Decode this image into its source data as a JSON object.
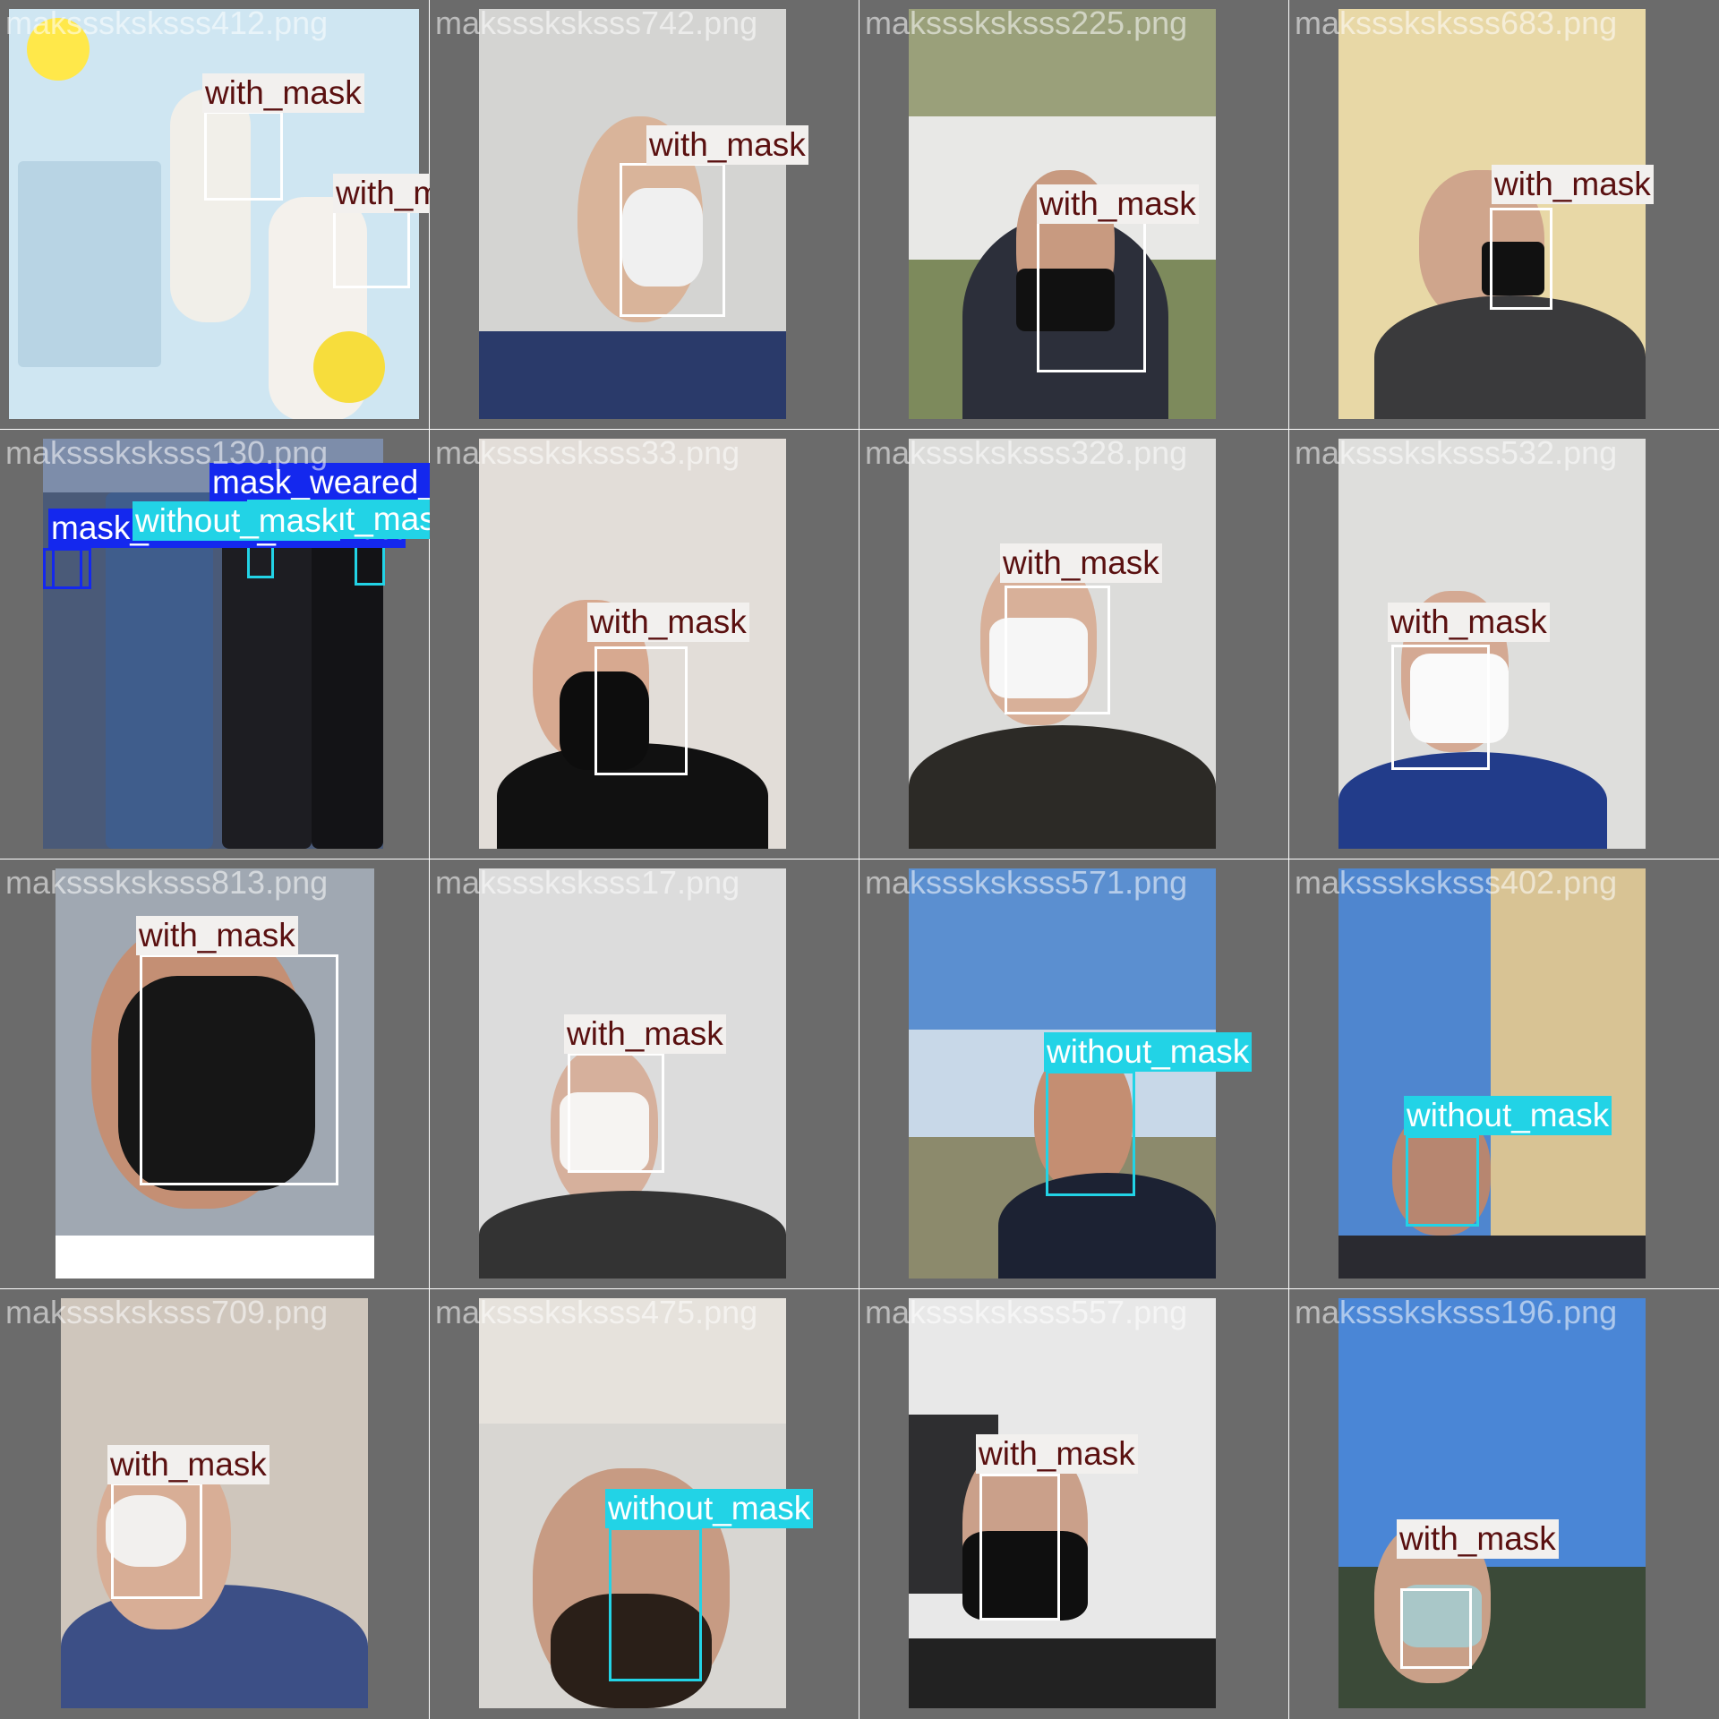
{
  "grid_title": "",
  "class_colors": {
    "with_mask": {
      "box": "#ffffff",
      "label_bg": "#f2f0ee",
      "label_fg": "#5a1010"
    },
    "without_mask": {
      "box": "#22d3e6",
      "label_bg": "#22d3e6",
      "label_fg": "#ffffff"
    },
    "mask_weared_incorrect": {
      "box": "#1428ee",
      "label_bg": "#1428ee",
      "label_fg": "#ffffff"
    }
  },
  "cells": [
    {
      "file": "maksssksksss412.png",
      "scene": "#cfe6f2",
      "detections": [
        {
          "cls": "with_mask",
          "label": "with_mask"
        },
        {
          "cls": "with_mask",
          "label": "with_mask"
        }
      ]
    },
    {
      "file": "maksssksksss742.png",
      "scene": "#d4d4d2",
      "detections": [
        {
          "cls": "with_mask",
          "label": "with_mask"
        }
      ]
    },
    {
      "file": "maksssksksss225.png",
      "scene": "#7d8a5c",
      "detections": [
        {
          "cls": "with_mask",
          "label": "with_mask"
        }
      ]
    },
    {
      "file": "maksssksksss683.png",
      "scene": "#e6d6a2",
      "detections": [
        {
          "cls": "with_mask",
          "label": "with_mask"
        }
      ]
    },
    {
      "file": "maksssksksss130.png",
      "scene": "#4a5a78",
      "detections": [
        {
          "cls": "mask_weared_incorrect",
          "label": "mask_weared_incorrect"
        },
        {
          "cls": "mask_weared_incorrect",
          "label": "mask_weared_incorrect"
        },
        {
          "cls": "without_mask",
          "label": "without_mask"
        },
        {
          "cls": "without_mask",
          "label": "without_mask"
        }
      ]
    },
    {
      "file": "maksssksksss33.png",
      "scene": "#e2ddd8",
      "detections": [
        {
          "cls": "with_mask",
          "label": "with_mask"
        }
      ]
    },
    {
      "file": "maksssksksss328.png",
      "scene": "#dcdcda",
      "detections": [
        {
          "cls": "with_mask",
          "label": "with_mask"
        }
      ]
    },
    {
      "file": "maksssksksss532.png",
      "scene": "#dededc",
      "detections": [
        {
          "cls": "with_mask",
          "label": "with_mask"
        }
      ]
    },
    {
      "file": "maksssksksss813.png",
      "scene": "#a8b0b8",
      "detections": [
        {
          "cls": "with_mask",
          "label": "with_mask"
        }
      ]
    },
    {
      "file": "maksssksksss17.png",
      "scene": "#dcdcdc",
      "detections": [
        {
          "cls": "with_mask",
          "label": "with_mask"
        }
      ]
    },
    {
      "file": "maksssksksss571.png",
      "scene": "#5b8fd0",
      "detections": [
        {
          "cls": "without_mask",
          "label": "without_mask"
        }
      ]
    },
    {
      "file": "maksssksksss402.png",
      "scene": "#4f86cf",
      "detections": [
        {
          "cls": "without_mask",
          "label": "without_mask"
        }
      ]
    },
    {
      "file": "maksssksksss709.png",
      "scene": "#cfc6bc",
      "detections": [
        {
          "cls": "with_mask",
          "label": "with_mask"
        }
      ]
    },
    {
      "file": "maksssksksss475.png",
      "scene": "#d8d6d2",
      "detections": [
        {
          "cls": "without_mask",
          "label": "without_mask"
        }
      ]
    },
    {
      "file": "maksssksksss557.png",
      "scene": "#e8e8e8",
      "detections": [
        {
          "cls": "with_mask",
          "label": "with_mask"
        }
      ]
    },
    {
      "file": "maksssksksss196.png",
      "scene": "#4a86d6",
      "detections": [
        {
          "cls": "with_mask",
          "label": "with_mask"
        }
      ]
    }
  ]
}
